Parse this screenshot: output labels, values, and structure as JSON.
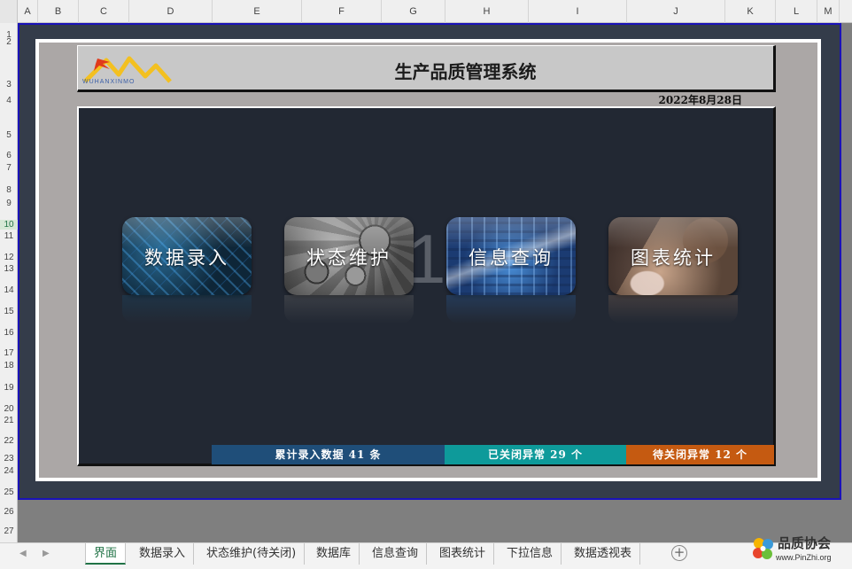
{
  "columns": [
    "A",
    "B",
    "C",
    "D",
    "E",
    "F",
    "G",
    "H",
    "I",
    "J",
    "K",
    "L",
    "M"
  ],
  "rows": [
    "1",
    "2",
    "3",
    "4",
    "5",
    "6",
    "7",
    "8",
    "9",
    "10",
    "11",
    "12",
    "13",
    "14",
    "15",
    "16",
    "17",
    "18",
    "19",
    "20",
    "21",
    "22",
    "23",
    "24",
    "25",
    "26",
    "27"
  ],
  "header": {
    "logo_text": "WUHANXINMO",
    "title": "生产品质管理系统",
    "date": "2022年8月28日"
  },
  "big_number": "1",
  "tiles": [
    {
      "label": "数据录入"
    },
    {
      "label": "状态维护"
    },
    {
      "label": "信息查询"
    },
    {
      "label": "图表统计"
    }
  ],
  "stats": {
    "total": "累计录入数据 41 条",
    "closed": "已关闭异常 29 个",
    "pending": "待关闭异常 12 个"
  },
  "sheet_tabs": [
    "界面",
    "数据录入",
    "状态维护(待关闭)",
    "数据库",
    "信息查询",
    "图表统计",
    "下拉信息",
    "数据透视表"
  ],
  "active_tab": "界面",
  "add_sheet": "+",
  "watermark": {
    "title": "品质协会",
    "url": "www.PinZhi.org"
  },
  "colors": {
    "stat_total": "#1f4e79",
    "stat_closed": "#0e9a9a",
    "stat_pending": "#c55a11",
    "panel_dark": "#222833",
    "frame_border": "#1a12b8"
  }
}
